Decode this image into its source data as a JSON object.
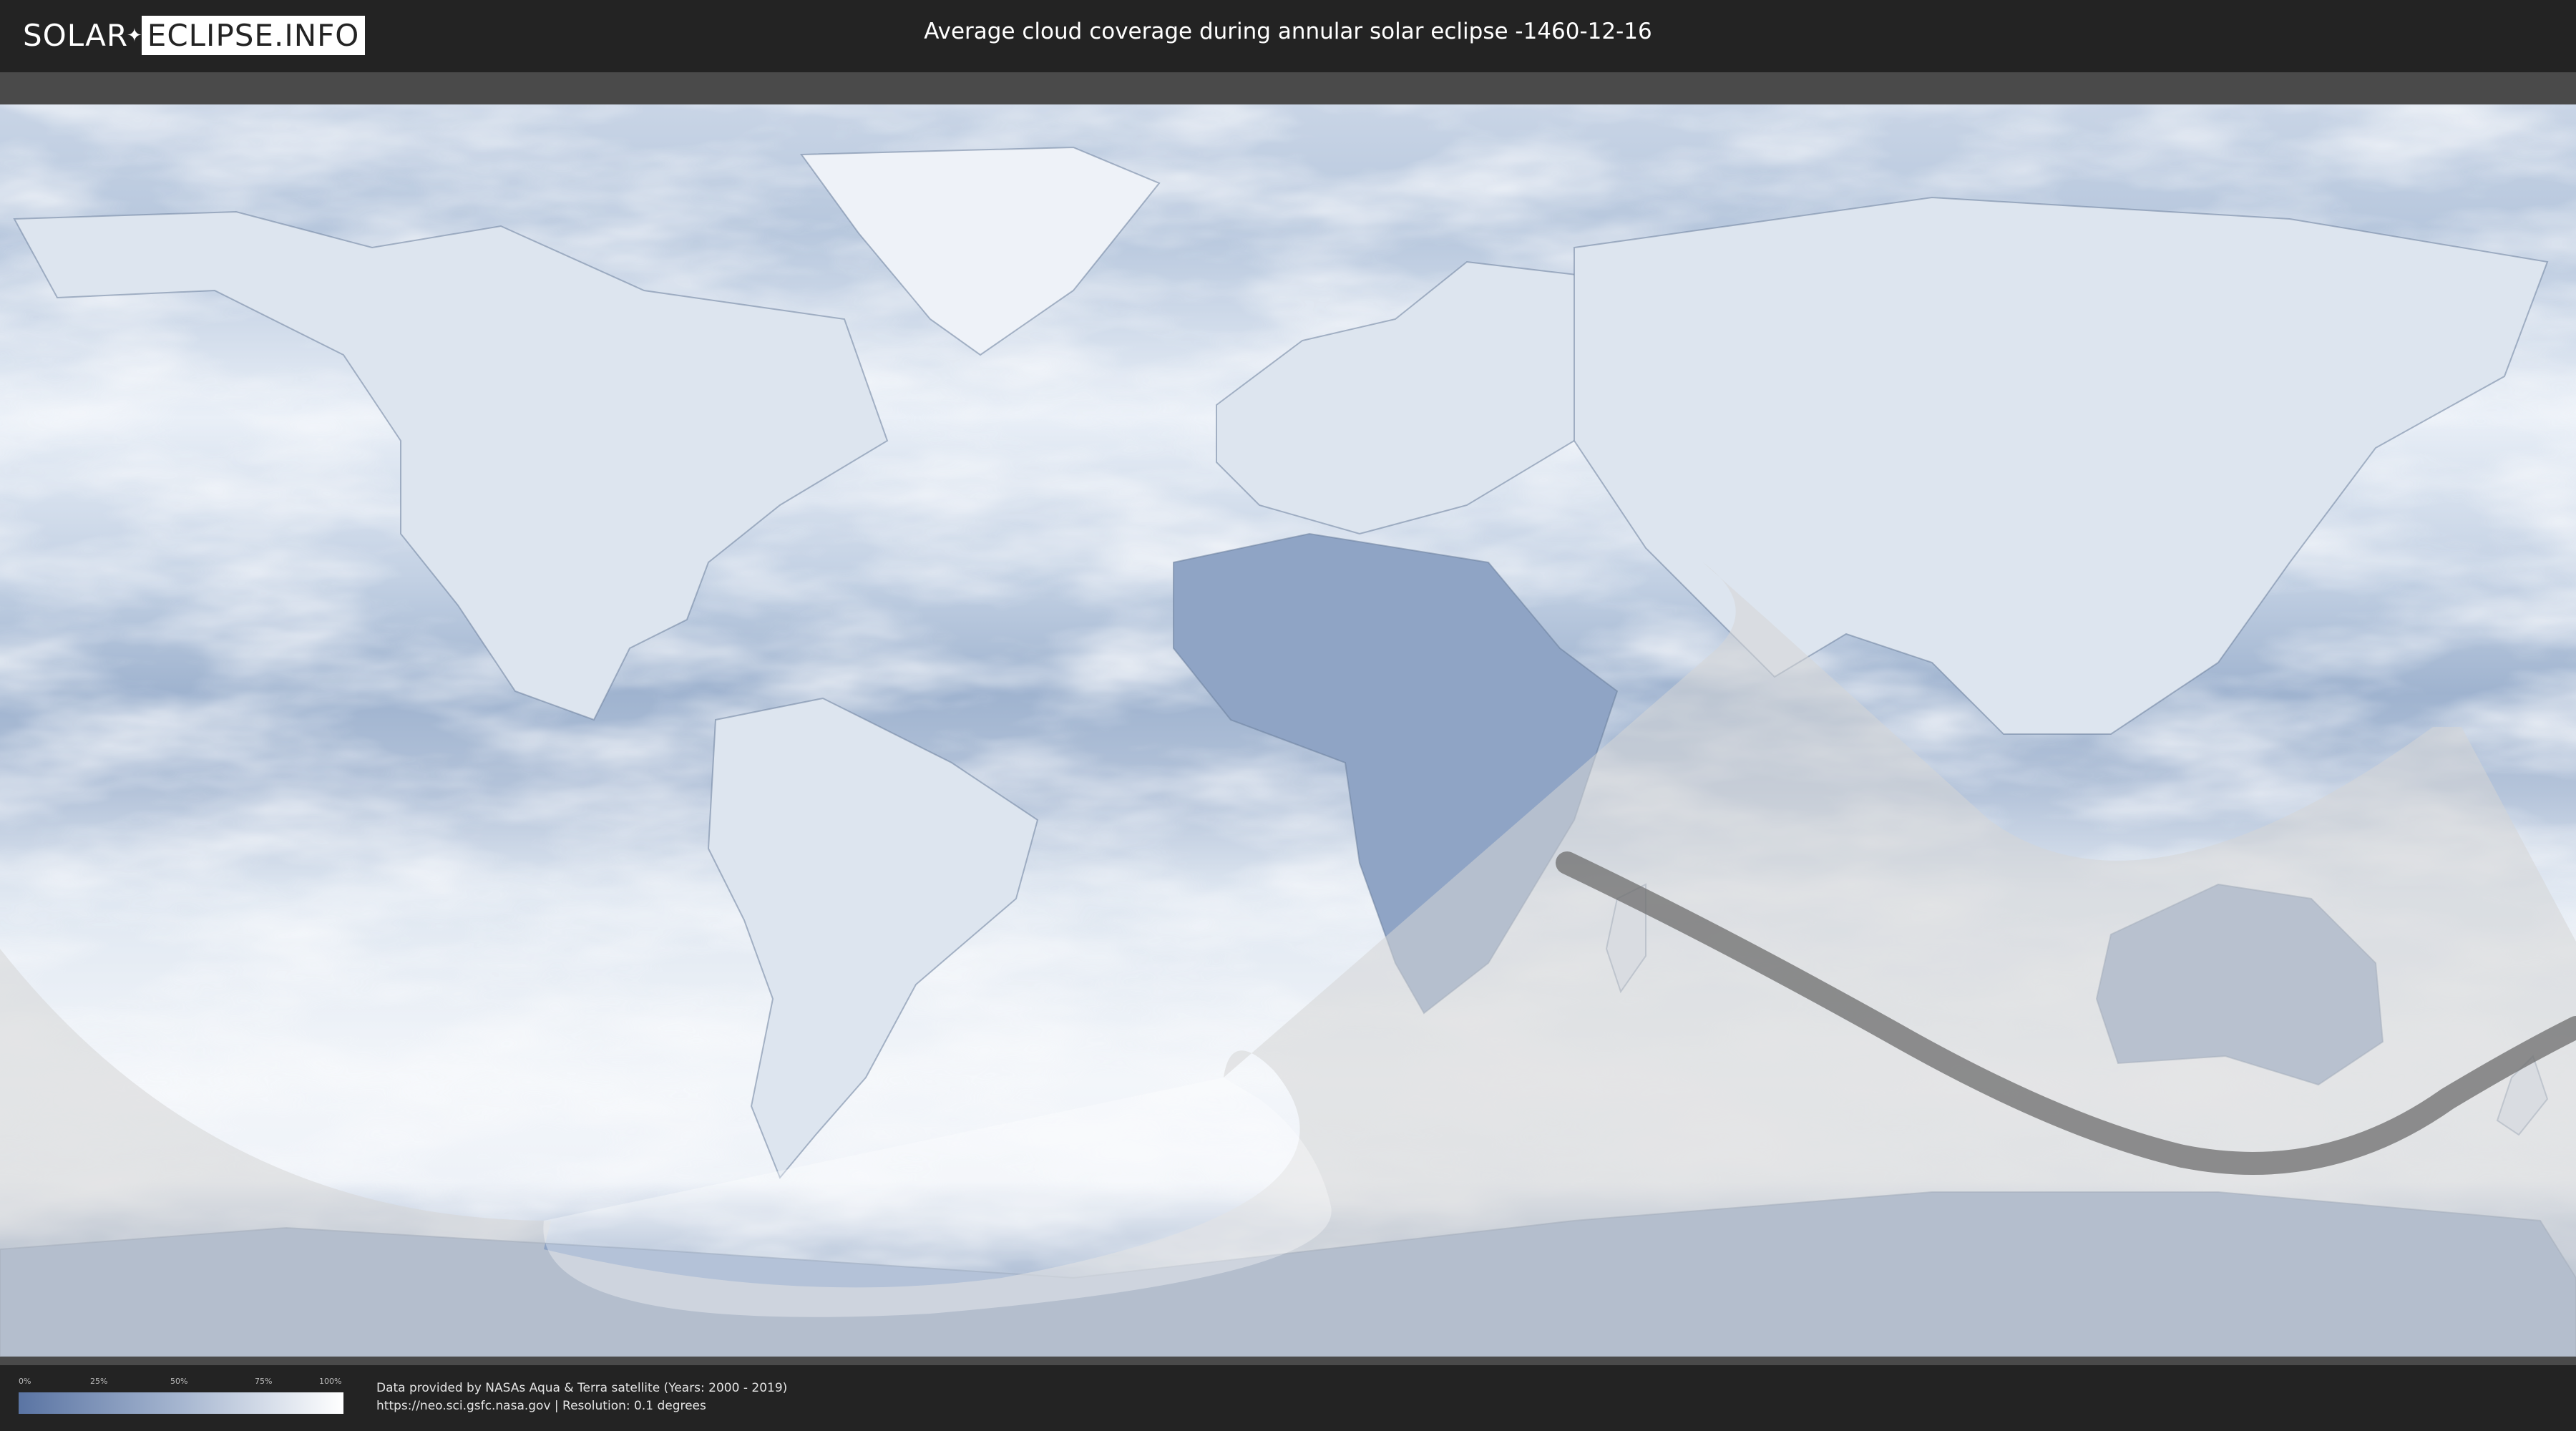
{
  "header": {
    "logo_part1": "SOLAR",
    "logo_part2": "ECLIPSE.INFO",
    "title": "Average cloud coverage during annular solar eclipse -1460-12-16"
  },
  "map": {
    "projection": "equirectangular",
    "ocean_cloud_color": "#a9bcd6",
    "clear_sky_color": "#5f7aa8",
    "cloudy_color": "#f4f7fb",
    "eclipse_shade_color": "#d6d6d6",
    "annular_path_color": "#6e6e6e"
  },
  "legend": {
    "ticks": [
      "0%",
      "25%",
      "50%",
      "75%",
      "100%"
    ],
    "gradient_start": "#5a74a3",
    "gradient_end": "#ffffff"
  },
  "footer": {
    "credit_line1": "Data provided by NASAs Aqua & Terra satellite (Years: 2000 - 2019)",
    "credit_line2": "https://neo.sci.gsfc.nasa.gov | Resolution: 0.1 degrees"
  }
}
